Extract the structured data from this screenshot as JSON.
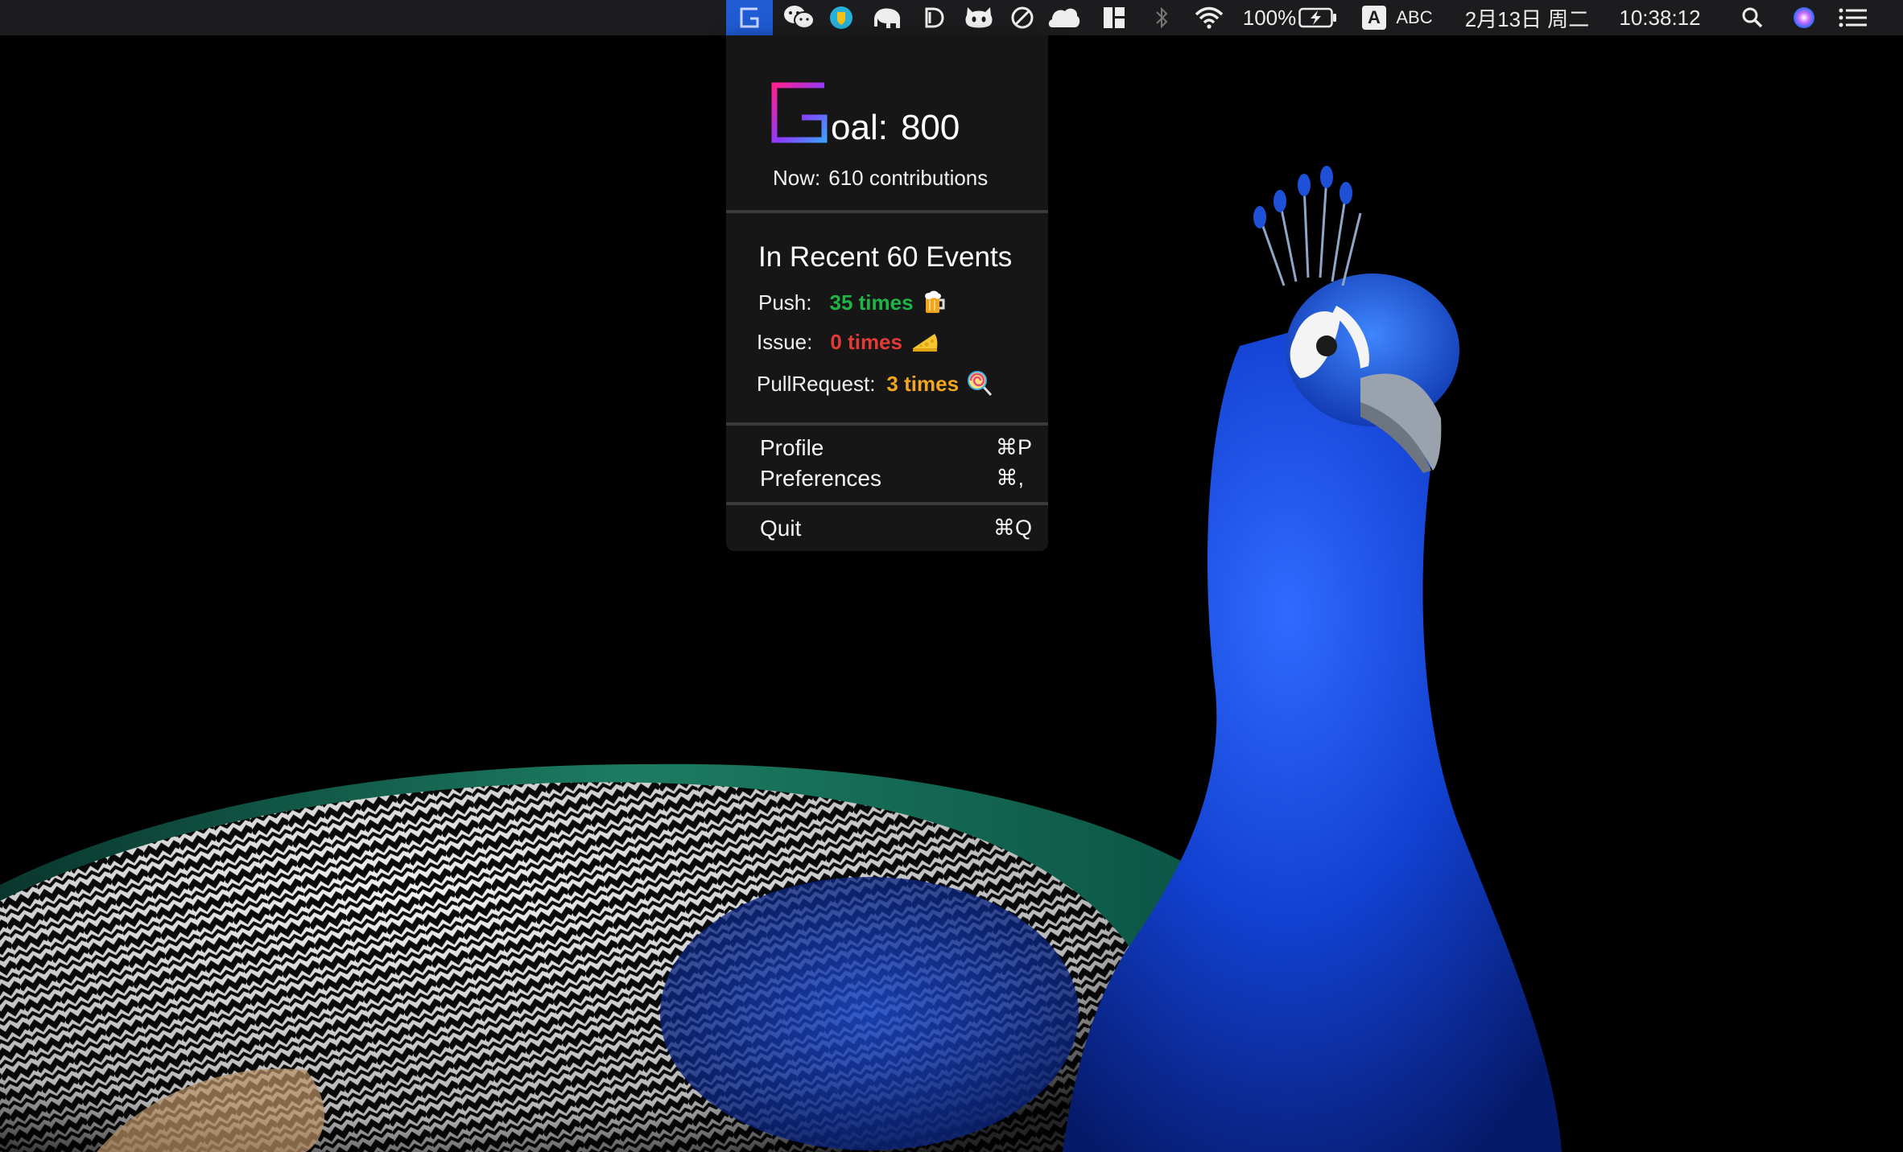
{
  "menubar": {
    "battery_percent": "100%",
    "input_source_badge": "A",
    "input_source": "ABC",
    "date": "2月13日 周二",
    "time": "10:38:12",
    "icons": [
      "github-goal-app-icon",
      "wechat-icon",
      "shield-app-icon",
      "elephant-icon",
      "d-app-icon",
      "github-octocat-icon",
      "no-disturb-icon",
      "cloud-icon",
      "tiles-icon",
      "bluetooth-icon",
      "wifi-icon",
      "battery-charging-icon",
      "spotlight-search-icon",
      "siri-icon",
      "notification-center-icon"
    ]
  },
  "dropdown": {
    "goal_label": "oal:",
    "goal_value": "800",
    "now_label": "Now:",
    "now_value": "610 contributions",
    "section_title": "In Recent 60 Events",
    "events": [
      {
        "label": "Push:",
        "value": "35 times",
        "color": "#1fb546",
        "emoji": "beer-mug-icon"
      },
      {
        "label": "Issue:",
        "value": "0 times",
        "color": "#e23a35",
        "emoji": "cheese-icon"
      },
      {
        "label": "PullRequest:",
        "value": "3 times",
        "color": "#f2a61f",
        "emoji": "lollipop-icon"
      }
    ],
    "menu": [
      {
        "label": "Profile",
        "shortcut": "⌘P"
      },
      {
        "label": "Preferences",
        "shortcut": "⌘,"
      },
      {
        "label": "Quit",
        "shortcut": "⌘Q"
      }
    ]
  },
  "colors": {
    "menubar_bg": "#1c1c1e",
    "menu_bg": "#161616",
    "highlight": "#1f5bd3",
    "logo_gradient": [
      "#ff1f8f",
      "#7a3cff",
      "#3ea0ff"
    ]
  }
}
